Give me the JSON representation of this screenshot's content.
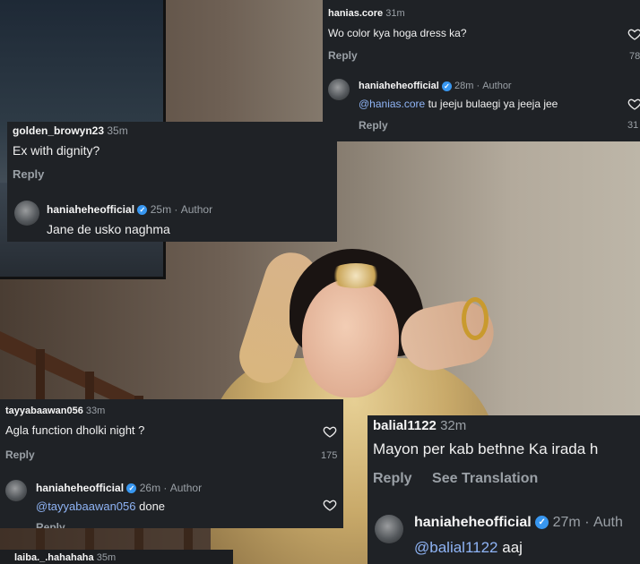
{
  "comments": {
    "c1": {
      "user": "hanias.core",
      "time": "31m",
      "text": "Wo color kya hoga dress ka?",
      "reply": "Reply",
      "likes": "78"
    },
    "c1r": {
      "user": "haniaheheofficial",
      "time": "28m",
      "author": "Author",
      "mention": "@hanias.core",
      "text": " tu jeeju bulaegi ya jeeja jee",
      "reply": "Reply",
      "likes": "31"
    },
    "c2": {
      "user": "golden_browyn23",
      "time": "35m",
      "text": "Ex with dignity?",
      "reply": "Reply"
    },
    "c2r": {
      "user": "haniaheheofficial",
      "time": "25m",
      "author": "Author",
      "text": "Jane de usko naghma"
    },
    "c3": {
      "user": "tayyabaawan056",
      "time": "33m",
      "text": "Agla function dholki night ?",
      "reply": "Reply",
      "likes": "175"
    },
    "c3r": {
      "user": "haniaheheofficial",
      "time": "26m",
      "author": "Author",
      "mention": "@tayyabaawan056",
      "text": " done",
      "reply": "Reply"
    },
    "c4": {
      "user": "balial1122",
      "time": "32m",
      "text": "Mayon per kab bethne Ka irada h",
      "reply": "Reply",
      "translate": "See Translation"
    },
    "c4r": {
      "user": "haniaheheofficial",
      "time": "27m",
      "author": "Auth",
      "mention": "@balial1122",
      "text": " aaj"
    },
    "c5": {
      "user": "laiba._.hahahaha",
      "time": "35m"
    }
  },
  "icons": {
    "heart": "heart-outline-icon",
    "verified": "verified-badge-icon"
  },
  "colors": {
    "card_bg": "#1f2226",
    "muted": "#9aa0a6",
    "mention": "#8fb4f5",
    "verified": "#3897f0"
  }
}
